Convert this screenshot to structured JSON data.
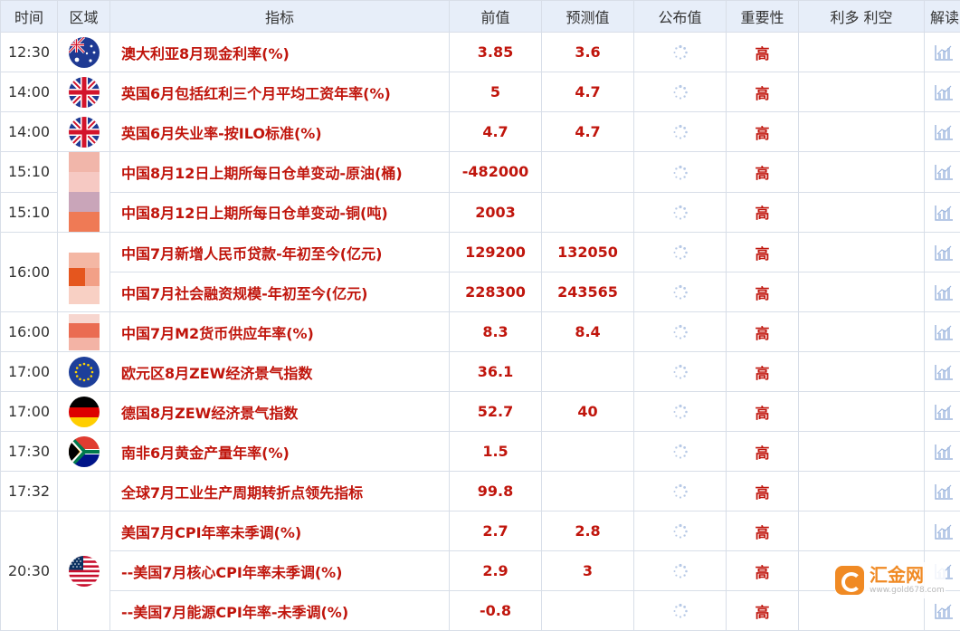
{
  "header": {
    "time": "时间",
    "region": "区域",
    "indicator": "指标",
    "previous": "前值",
    "forecast": "预测值",
    "actual": "公布值",
    "importance": "重要性",
    "impact": "利多 利空",
    "analysis": "解读"
  },
  "rows": [
    {
      "time": "12:30",
      "indicator": "澳大利亚8月现金利率(%)",
      "previous": "3.85",
      "forecast": "3.6",
      "importance": "高"
    },
    {
      "time": "14:00",
      "indicator": "英国6月包括红利三个月平均工资年率(%)",
      "previous": "5",
      "forecast": "4.7",
      "importance": "高"
    },
    {
      "time": "14:00",
      "indicator": "英国6月失业率-按ILO标准(%)",
      "previous": "4.7",
      "forecast": "4.7",
      "importance": "高"
    },
    {
      "time": "15:10",
      "indicator": "中国8月12日上期所每日仓单变动-原油(桶)",
      "previous": "-482000",
      "forecast": "",
      "importance": "高"
    },
    {
      "time": "15:10",
      "indicator": "中国8月12日上期所每日仓单变动-铜(吨)",
      "previous": "2003",
      "forecast": "",
      "importance": "高"
    },
    {
      "time": "16:00",
      "indicator": "中国7月新增人民币贷款-年初至今(亿元)",
      "previous": "129200",
      "forecast": "132050",
      "importance": "高"
    },
    {
      "time": "",
      "indicator": "中国7月社会融资规模-年初至今(亿元)",
      "previous": "228300",
      "forecast": "243565",
      "importance": "高"
    },
    {
      "time": "16:00",
      "indicator": "中国7月M2货币供应年率(%)",
      "previous": "8.3",
      "forecast": "8.4",
      "importance": "高"
    },
    {
      "time": "17:00",
      "indicator": "欧元区8月ZEW经济景气指数",
      "previous": "36.1",
      "forecast": "",
      "importance": "高"
    },
    {
      "time": "17:00",
      "indicator": "德国8月ZEW经济景气指数",
      "previous": "52.7",
      "forecast": "40",
      "importance": "高"
    },
    {
      "time": "17:30",
      "indicator": "南非6月黄金产量年率(%)",
      "previous": "1.5",
      "forecast": "",
      "importance": "高"
    },
    {
      "time": "17:32",
      "indicator": "全球7月工业生产周期转折点领先指标",
      "previous": "99.8",
      "forecast": "",
      "importance": "高"
    },
    {
      "time": "20:30",
      "indicator": "美国7月CPI年率未季调(%)",
      "previous": "2.7",
      "forecast": "2.8",
      "importance": "高"
    },
    {
      "time": "",
      "indicator": "--美国7月核心CPI年率未季调(%)",
      "previous": "2.9",
      "forecast": "3",
      "importance": "高"
    },
    {
      "time": "",
      "indicator": "--美国7月能源CPI年率-未季调(%)",
      "previous": "-0.8",
      "forecast": "",
      "importance": "高"
    }
  ],
  "watermark": {
    "name": "汇金网",
    "url": "www.gold678.com"
  },
  "icons": {
    "loading": "loading-spinner-icon",
    "chart": "bar-chart-icon"
  }
}
